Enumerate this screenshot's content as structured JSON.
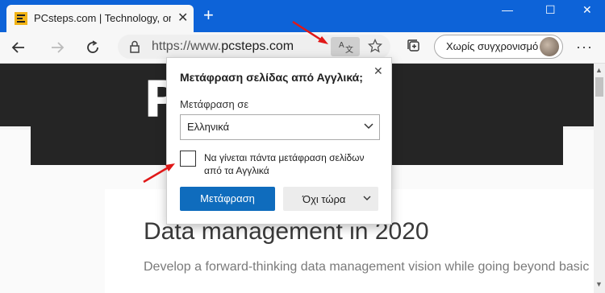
{
  "tab": {
    "title": "PCsteps.com | Technology, one s",
    "favicon": "pcsteps-favicon",
    "close": "✕"
  },
  "window": {
    "minimize": "—",
    "maximize": "☐",
    "close": "✕",
    "new_tab": "+"
  },
  "address": {
    "proto": "https://www.",
    "domain": "pcsteps.com"
  },
  "profile": {
    "label": "Χωρίς συγχρονισμό"
  },
  "site": {
    "logo": "P    PS",
    "article_title": "Data management in 2020",
    "article_desc": "Develop a forward-thinking data management vision while going beyond basic"
  },
  "popup": {
    "title": "Μετάφραση σελίδας από Αγγλικά;",
    "to_label": "Μετάφραση σε",
    "language": "Ελληνικά",
    "always_label": "Να γίνεται πάντα μετάφραση σελίδων από τα Αγγλικά",
    "always_checked": false,
    "translate_button": "Μετάφραση",
    "not_now_button": "Όχι τώρα"
  },
  "colors": {
    "titlebar": "#0d63d8",
    "primary_button": "#0f6cbd",
    "annotation_arrow": "#e01818"
  }
}
